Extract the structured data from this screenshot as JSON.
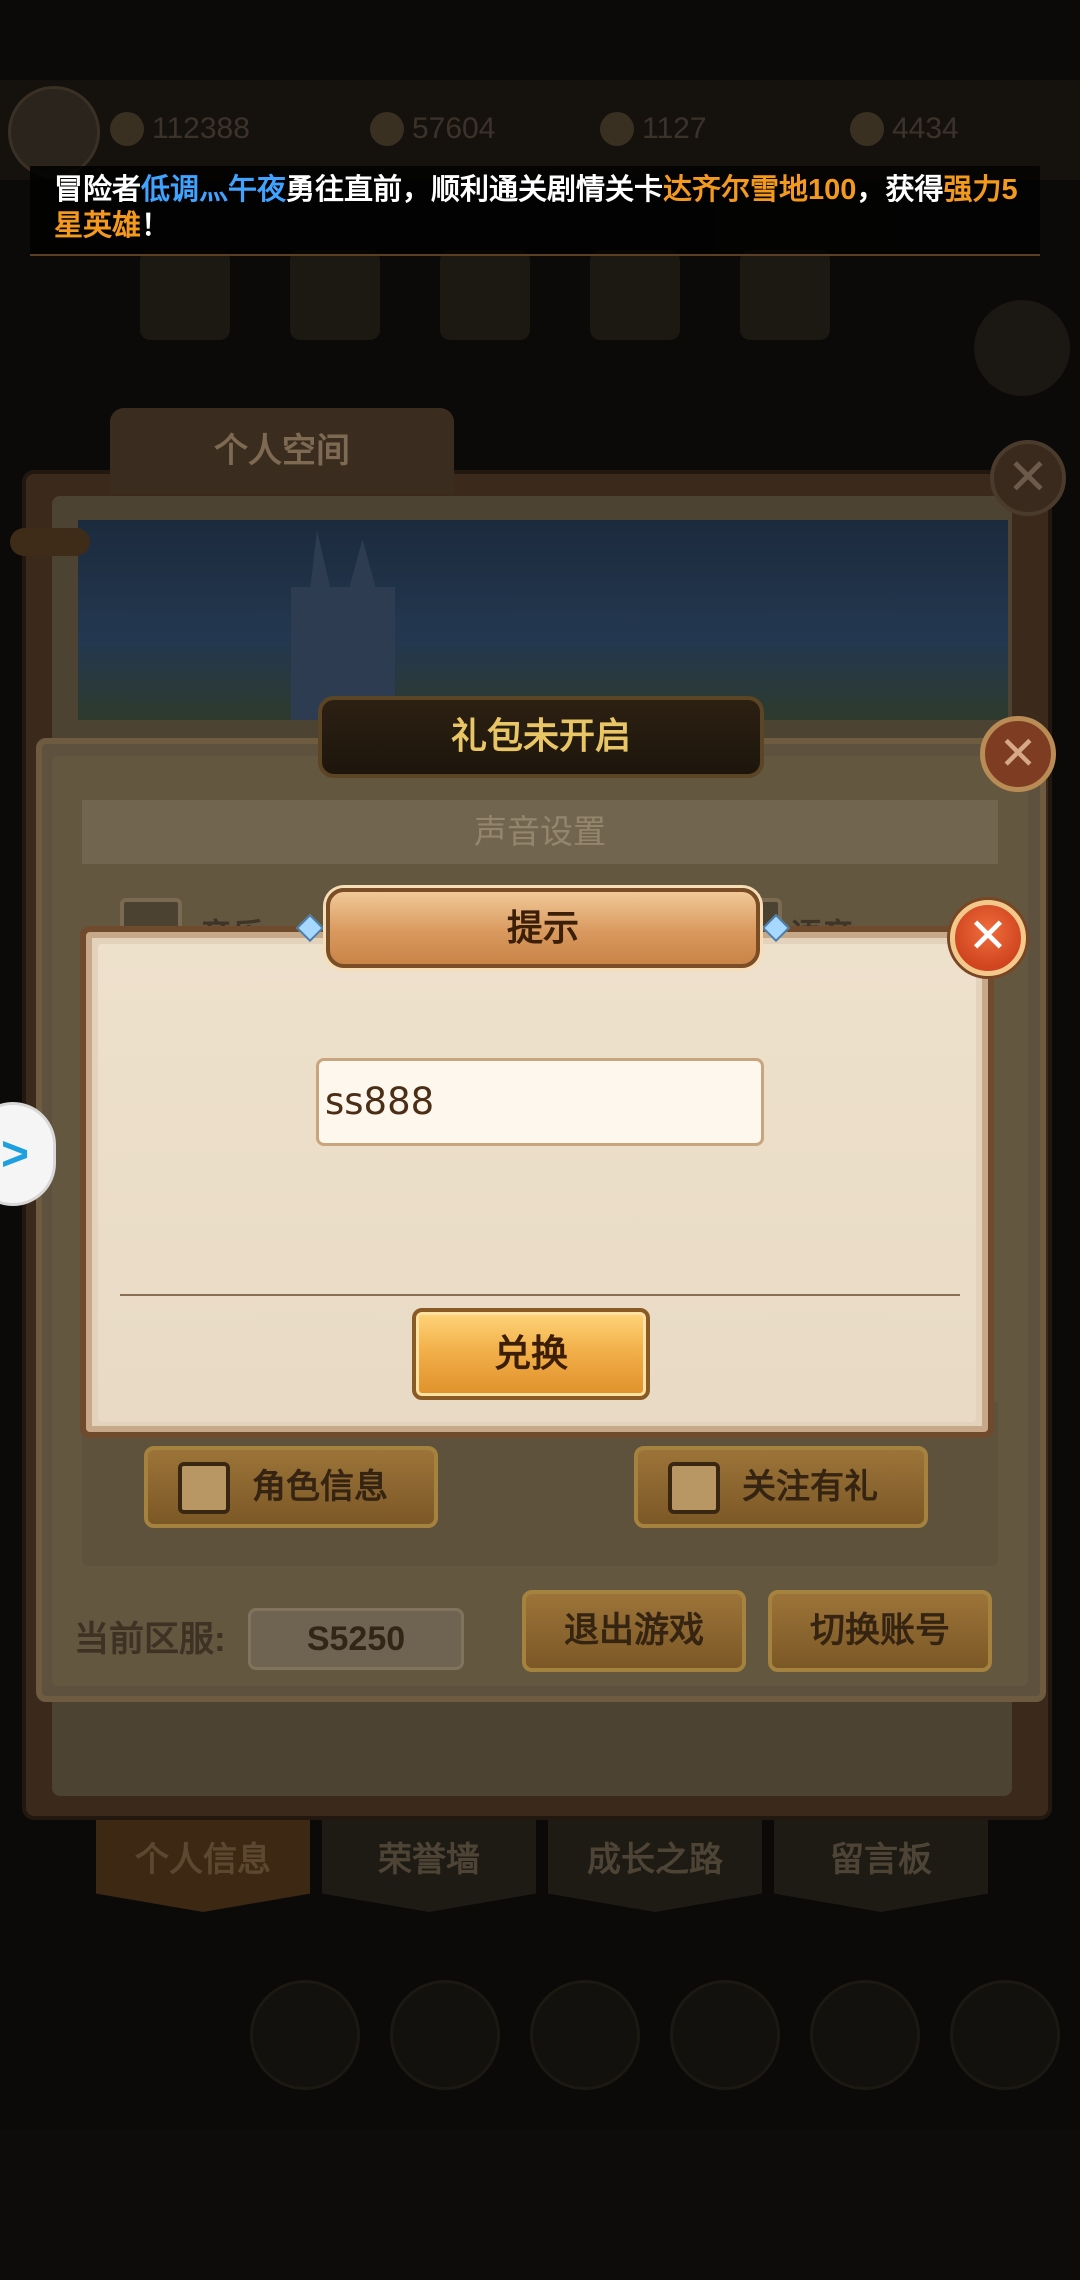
{
  "top_bar": {
    "resources": [
      {
        "icon": "gold-coin-icon",
        "value": "112388"
      },
      {
        "icon": "power-icon",
        "value": "57604"
      },
      {
        "icon": "stamina-icon",
        "value": "1127"
      },
      {
        "icon": "diamond-icon",
        "value": "4434"
      }
    ]
  },
  "ticker": {
    "prefix": "冒险者",
    "player_name": "低调灬午夜",
    "middle": "勇往直前，顺利通关剧情关卡",
    "stage": "达齐尔雪地100",
    "suffix_1": "，获得",
    "reward": "强力5星英雄",
    "suffix_2": "！"
  },
  "personal_space": {
    "tab_label": "个人空间",
    "bottom_tabs": [
      "个人信息",
      "荣誉墙",
      "成长之路",
      "留言板"
    ]
  },
  "settings_dialog": {
    "title": "礼包未开启",
    "sound_section": "声音设置",
    "music_label": "音乐",
    "voice_label": "语音",
    "role_info_button": "角色信息",
    "follow_gift_button": "关注有礼",
    "server_label": "当前区服:",
    "server_value": "S5250",
    "exit_button": "退出游戏",
    "switch_account_button": "切换账号"
  },
  "prompt_dialog": {
    "title": "提示",
    "code_value": "ss888",
    "redeem_button": "兑换"
  },
  "colors": {
    "ticker_name": "#3fa3ff",
    "ticker_highlight": "#f39a1e",
    "button_gold": "#f2b04b",
    "close_red": "#d0451f"
  }
}
